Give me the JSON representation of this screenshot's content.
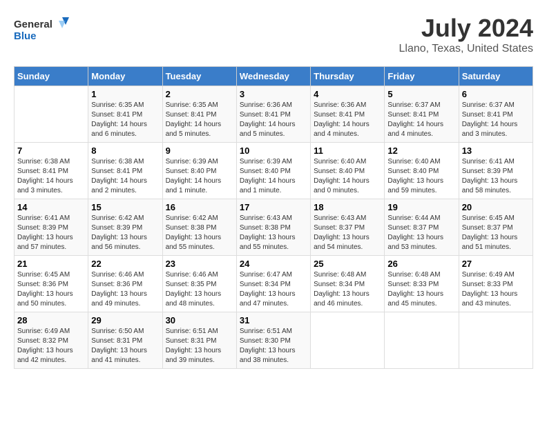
{
  "logo": {
    "line1": "General",
    "line2": "Blue"
  },
  "title": "July 2024",
  "subtitle": "Llano, Texas, United States",
  "days_of_week": [
    "Sunday",
    "Monday",
    "Tuesday",
    "Wednesday",
    "Thursday",
    "Friday",
    "Saturday"
  ],
  "weeks": [
    [
      {
        "day": "",
        "info": ""
      },
      {
        "day": "1",
        "info": "Sunrise: 6:35 AM\nSunset: 8:41 PM\nDaylight: 14 hours\nand 6 minutes."
      },
      {
        "day": "2",
        "info": "Sunrise: 6:35 AM\nSunset: 8:41 PM\nDaylight: 14 hours\nand 5 minutes."
      },
      {
        "day": "3",
        "info": "Sunrise: 6:36 AM\nSunset: 8:41 PM\nDaylight: 14 hours\nand 5 minutes."
      },
      {
        "day": "4",
        "info": "Sunrise: 6:36 AM\nSunset: 8:41 PM\nDaylight: 14 hours\nand 4 minutes."
      },
      {
        "day": "5",
        "info": "Sunrise: 6:37 AM\nSunset: 8:41 PM\nDaylight: 14 hours\nand 4 minutes."
      },
      {
        "day": "6",
        "info": "Sunrise: 6:37 AM\nSunset: 8:41 PM\nDaylight: 14 hours\nand 3 minutes."
      }
    ],
    [
      {
        "day": "7",
        "info": "Sunrise: 6:38 AM\nSunset: 8:41 PM\nDaylight: 14 hours\nand 3 minutes."
      },
      {
        "day": "8",
        "info": "Sunrise: 6:38 AM\nSunset: 8:41 PM\nDaylight: 14 hours\nand 2 minutes."
      },
      {
        "day": "9",
        "info": "Sunrise: 6:39 AM\nSunset: 8:40 PM\nDaylight: 14 hours\nand 1 minute."
      },
      {
        "day": "10",
        "info": "Sunrise: 6:39 AM\nSunset: 8:40 PM\nDaylight: 14 hours\nand 1 minute."
      },
      {
        "day": "11",
        "info": "Sunrise: 6:40 AM\nSunset: 8:40 PM\nDaylight: 14 hours\nand 0 minutes."
      },
      {
        "day": "12",
        "info": "Sunrise: 6:40 AM\nSunset: 8:40 PM\nDaylight: 13 hours\nand 59 minutes."
      },
      {
        "day": "13",
        "info": "Sunrise: 6:41 AM\nSunset: 8:39 PM\nDaylight: 13 hours\nand 58 minutes."
      }
    ],
    [
      {
        "day": "14",
        "info": "Sunrise: 6:41 AM\nSunset: 8:39 PM\nDaylight: 13 hours\nand 57 minutes."
      },
      {
        "day": "15",
        "info": "Sunrise: 6:42 AM\nSunset: 8:39 PM\nDaylight: 13 hours\nand 56 minutes."
      },
      {
        "day": "16",
        "info": "Sunrise: 6:42 AM\nSunset: 8:38 PM\nDaylight: 13 hours\nand 55 minutes."
      },
      {
        "day": "17",
        "info": "Sunrise: 6:43 AM\nSunset: 8:38 PM\nDaylight: 13 hours\nand 55 minutes."
      },
      {
        "day": "18",
        "info": "Sunrise: 6:43 AM\nSunset: 8:37 PM\nDaylight: 13 hours\nand 54 minutes."
      },
      {
        "day": "19",
        "info": "Sunrise: 6:44 AM\nSunset: 8:37 PM\nDaylight: 13 hours\nand 53 minutes."
      },
      {
        "day": "20",
        "info": "Sunrise: 6:45 AM\nSunset: 8:37 PM\nDaylight: 13 hours\nand 51 minutes."
      }
    ],
    [
      {
        "day": "21",
        "info": "Sunrise: 6:45 AM\nSunset: 8:36 PM\nDaylight: 13 hours\nand 50 minutes."
      },
      {
        "day": "22",
        "info": "Sunrise: 6:46 AM\nSunset: 8:36 PM\nDaylight: 13 hours\nand 49 minutes."
      },
      {
        "day": "23",
        "info": "Sunrise: 6:46 AM\nSunset: 8:35 PM\nDaylight: 13 hours\nand 48 minutes."
      },
      {
        "day": "24",
        "info": "Sunrise: 6:47 AM\nSunset: 8:34 PM\nDaylight: 13 hours\nand 47 minutes."
      },
      {
        "day": "25",
        "info": "Sunrise: 6:48 AM\nSunset: 8:34 PM\nDaylight: 13 hours\nand 46 minutes."
      },
      {
        "day": "26",
        "info": "Sunrise: 6:48 AM\nSunset: 8:33 PM\nDaylight: 13 hours\nand 45 minutes."
      },
      {
        "day": "27",
        "info": "Sunrise: 6:49 AM\nSunset: 8:33 PM\nDaylight: 13 hours\nand 43 minutes."
      }
    ],
    [
      {
        "day": "28",
        "info": "Sunrise: 6:49 AM\nSunset: 8:32 PM\nDaylight: 13 hours\nand 42 minutes."
      },
      {
        "day": "29",
        "info": "Sunrise: 6:50 AM\nSunset: 8:31 PM\nDaylight: 13 hours\nand 41 minutes."
      },
      {
        "day": "30",
        "info": "Sunrise: 6:51 AM\nSunset: 8:31 PM\nDaylight: 13 hours\nand 39 minutes."
      },
      {
        "day": "31",
        "info": "Sunrise: 6:51 AM\nSunset: 8:30 PM\nDaylight: 13 hours\nand 38 minutes."
      },
      {
        "day": "",
        "info": ""
      },
      {
        "day": "",
        "info": ""
      },
      {
        "day": "",
        "info": ""
      }
    ]
  ]
}
